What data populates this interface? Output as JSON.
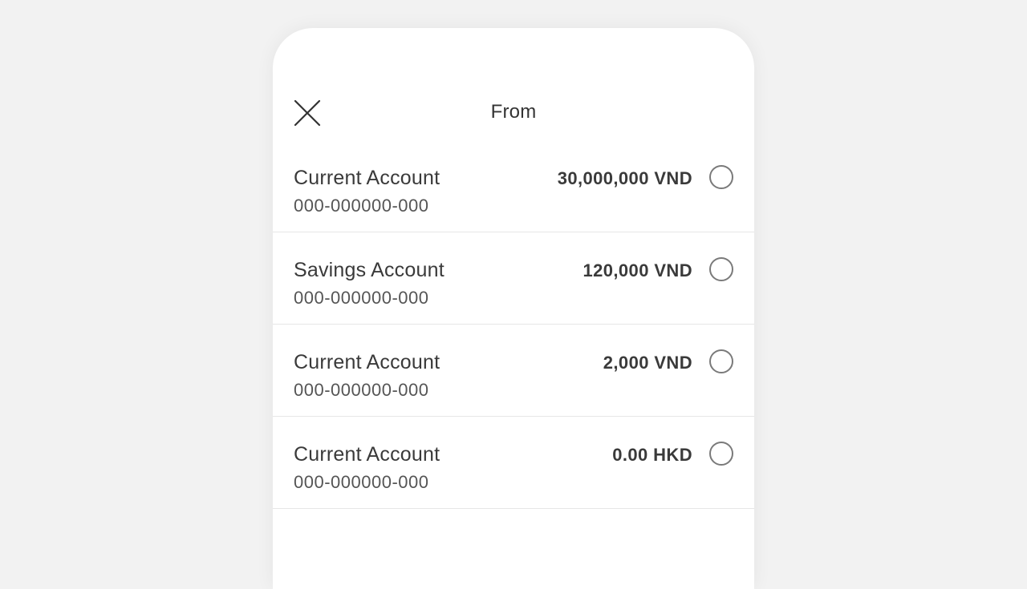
{
  "header": {
    "title": "From",
    "close_icon": "close-icon"
  },
  "accounts": [
    {
      "name": "Current Account",
      "number": "000-000000-000",
      "amount": "30,000,000 VND",
      "selected": false
    },
    {
      "name": "Savings Account",
      "number": "000-000000-000",
      "amount": "120,000 VND",
      "selected": false
    },
    {
      "name": "Current Account",
      "number": "000-000000-000",
      "amount": "2,000 VND",
      "selected": false
    },
    {
      "name": "Current Account",
      "number": "000-000000-000",
      "amount": "0.00 HKD",
      "selected": false
    }
  ],
  "colors": {
    "background": "#f2f2f2",
    "sheet": "#ffffff",
    "text": "#333333",
    "divider": "#e6e6e6",
    "radio_border": "#7a7a7a"
  }
}
